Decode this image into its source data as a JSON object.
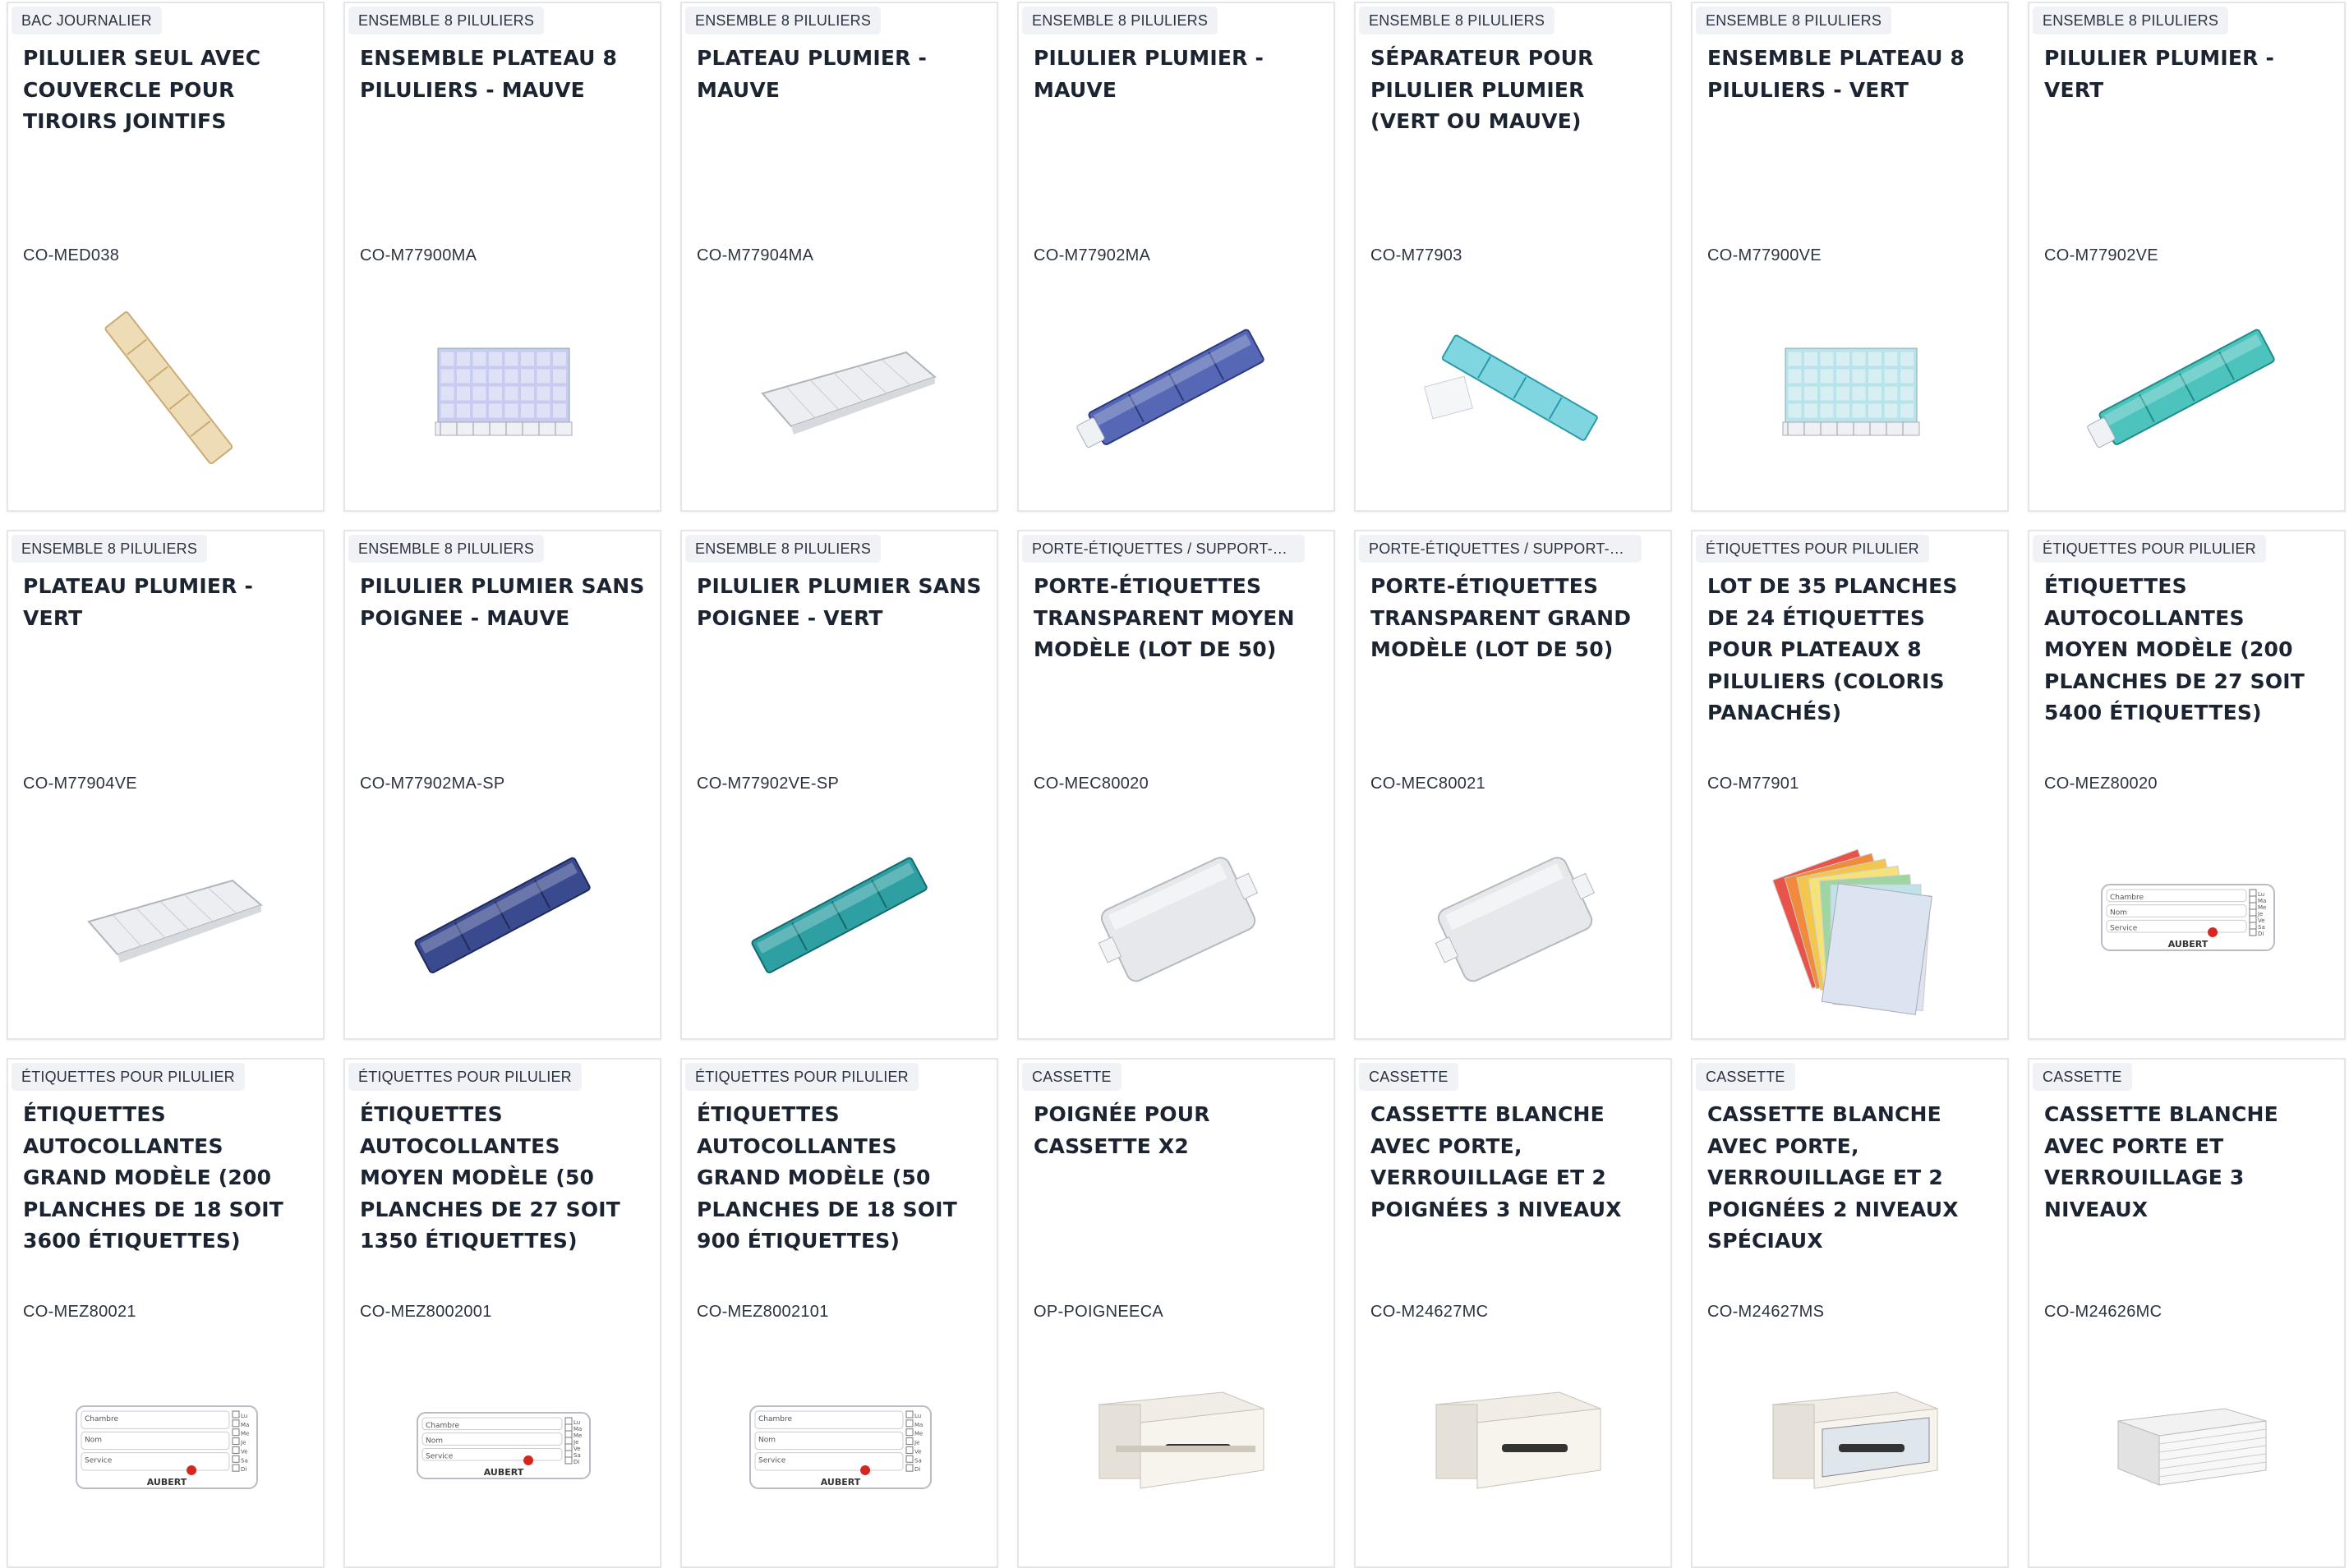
{
  "colors": {
    "card_border": "#e4e6ea",
    "badge_bg": "#f1f2f5",
    "text": "#1b2430",
    "mauve": "#3b4b93",
    "vert": "#3cb4b4"
  },
  "products": [
    {
      "category": "BAC JOURNALIER",
      "title": "PILULIER SEUL AVEC COUVERCLE POUR TIROIRS JOINTIFS",
      "ref": "CO-MED038",
      "icon": "beige-pill-box-icon"
    },
    {
      "category": "ENSEMBLE 8 PILULIERS",
      "title": "ENSEMBLE PLATEAU 8 PILULIERS - MAUVE",
      "ref": "CO-M77900MA",
      "icon": "mauve-tray-set-icon"
    },
    {
      "category": "ENSEMBLE 8 PILULIERS",
      "title": "PLATEAU PLUMIER - MAUVE",
      "ref": "CO-M77904MA",
      "icon": "clear-tray-icon"
    },
    {
      "category": "ENSEMBLE 8 PILULIERS",
      "title": "PILULIER PLUMIER - MAUVE",
      "ref": "CO-M77902MA",
      "icon": "mauve-pill-box-icon"
    },
    {
      "category": "ENSEMBLE 8 PILULIERS",
      "title": "SÉPARATEUR POUR PILULIER PLUMIER (VERT OU MAUVE)",
      "ref": "CO-M77903",
      "icon": "separator-icon"
    },
    {
      "category": "ENSEMBLE 8 PILULIERS",
      "title": "ENSEMBLE PLATEAU 8 PILULIERS - VERT",
      "ref": "CO-M77900VE",
      "icon": "green-tray-set-icon"
    },
    {
      "category": "ENSEMBLE 8 PILULIERS",
      "title": "PILULIER PLUMIER - VERT",
      "ref": "CO-M77902VE",
      "icon": "green-pill-box-icon"
    },
    {
      "category": "ENSEMBLE 8 PILULIERS",
      "title": "PLATEAU PLUMIER - VERT",
      "ref": "CO-M77904VE",
      "icon": "clear-tray-icon"
    },
    {
      "category": "ENSEMBLE 8 PILULIERS",
      "title": "PILULIER PLUMIER SANS POIGNEE - MAUVE",
      "ref": "CO-M77902MA-SP",
      "icon": "mauve-box-no-handle-icon"
    },
    {
      "category": "ENSEMBLE 8 PILULIERS",
      "title": "PILULIER PLUMIER SANS POIGNEE - VERT",
      "ref": "CO-M77902VE-SP",
      "icon": "green-box-no-handle-icon"
    },
    {
      "category": "PORTE-ÉTIQUETTES / SUPPORT-E ...",
      "title": "PORTE-ÉTIQUETTES TRANSPARENT MOYEN MODÈLE (LOT DE 50)",
      "ref": "CO-MEC80020",
      "icon": "label-holder-icon"
    },
    {
      "category": "PORTE-ÉTIQUETTES / SUPPORT-E ...",
      "title": "PORTE-ÉTIQUETTES TRANSPARENT GRAND MODÈLE (LOT DE 50)",
      "ref": "CO-MEC80021",
      "icon": "label-holder-icon"
    },
    {
      "category": "ÉTIQUETTES POUR PILULIER",
      "title": "LOT DE 35 PLANCHES DE 24 ÉTIQUETTES POUR PLATEAUX 8 PILULIERS (COLORIS PANACHÉS)",
      "ref": "CO-M77901",
      "icon": "label-sheets-icon"
    },
    {
      "category": "ÉTIQUETTES POUR PILULIER",
      "title": "ÉTIQUETTES AUTOCOLLANTES MOYEN MODÈLE (200 PLANCHES DE 27 SOIT 5400 ÉTIQUETTES)",
      "ref": "CO-MEZ80020",
      "icon": "sticker-label-small-icon"
    },
    {
      "category": "ÉTIQUETTES POUR PILULIER",
      "title": "ÉTIQUETTES AUTOCOLLANTES GRAND MODÈLE (200 PLANCHES DE 18 SOIT 3600 ÉTIQUETTES)",
      "ref": "CO-MEZ80021",
      "icon": "sticker-label-large-icon"
    },
    {
      "category": "ÉTIQUETTES POUR PILULIER",
      "title": "ÉTIQUETTES AUTOCOLLANTES MOYEN MODÈLE (50 PLANCHES DE 27 SOIT 1350 ÉTIQUETTES)",
      "ref": "CO-MEZ8002001",
      "icon": "sticker-label-small-icon"
    },
    {
      "category": "ÉTIQUETTES POUR PILULIER",
      "title": "ÉTIQUETTES AUTOCOLLANTES GRAND MODÈLE (50 PLANCHES DE 18 SOIT 900 ÉTIQUETTES)",
      "ref": "CO-MEZ8002101",
      "icon": "sticker-label-large-icon"
    },
    {
      "category": "CASSETTE",
      "title": "POIGNÉE POUR CASSETTE X2",
      "ref": "OP-POIGNEECA",
      "icon": "cassette-handle-icon"
    },
    {
      "category": "CASSETTE",
      "title": "CASSETTE BLANCHE AVEC PORTE, VERROUILLAGE ET 2 POIGNÉES 3 NIVEAUX",
      "ref": "CO-M24627MC",
      "icon": "cassette-icon"
    },
    {
      "category": "CASSETTE",
      "title": "CASSETTE BLANCHE AVEC PORTE, VERROUILLAGE ET 2 POIGNÉES 2 NIVEAUX SPÉCIAUX",
      "ref": "CO-M24627MS",
      "icon": "open-cassette-icon"
    },
    {
      "category": "CASSETTE",
      "title": "CASSETTE BLANCHE AVEC PORTE ET VERROUILLAGE 3 NIVEAUX",
      "ref": "CO-M24626MC",
      "icon": "closed-cassette-icon"
    }
  ],
  "label_texts": {
    "chambre": "Chambre",
    "nom": "Nom",
    "service": "Service",
    "brand": "AUBERT",
    "days": [
      "Lu",
      "Ma",
      "Me",
      "Je",
      "Ve",
      "Sa",
      "Di"
    ]
  }
}
